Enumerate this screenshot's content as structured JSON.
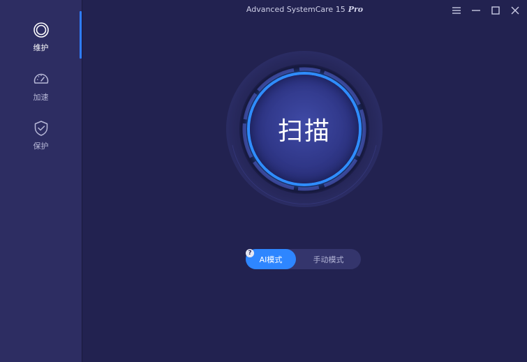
{
  "app": {
    "title": "Advanced SystemCare 15",
    "edition": "Pro"
  },
  "sidebar": {
    "items": [
      {
        "label": "维护",
        "icon": "maintenance-ring-icon",
        "active": true
      },
      {
        "label": "加速",
        "icon": "speedometer-icon",
        "active": false
      },
      {
        "label": "保护",
        "icon": "shield-check-icon",
        "active": false
      }
    ]
  },
  "window_controls": {
    "icons": [
      "menu-icon",
      "minimize-icon",
      "maximize-icon",
      "close-icon"
    ]
  },
  "main": {
    "scan_button_label": "扫描",
    "mode_toggle": {
      "options": [
        "AI模式",
        "手动模式"
      ],
      "selected": "AI模式",
      "help_symbol": "?"
    }
  },
  "colors": {
    "accent": "#2f86ff",
    "sidebar_bg": "#2d2d62",
    "main_bg": "#222250"
  }
}
